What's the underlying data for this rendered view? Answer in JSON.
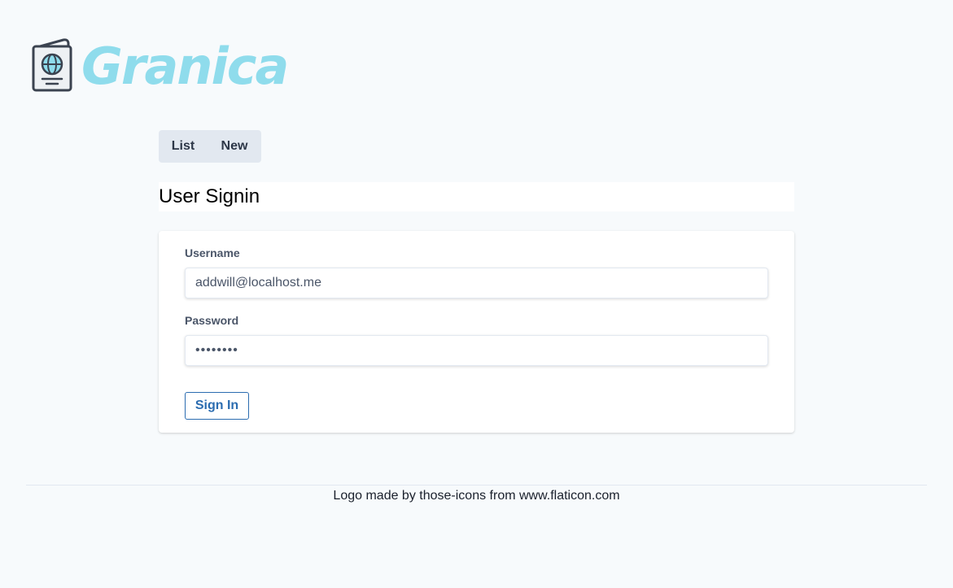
{
  "brand": {
    "name": "Granica",
    "icon": "passport-icon",
    "color": "#8fdcec"
  },
  "nav": {
    "list_label": "List",
    "new_label": "New"
  },
  "page": {
    "title": "User Signin"
  },
  "form": {
    "username_label": "Username",
    "username_value": "addwill@localhost.me",
    "password_label": "Password",
    "password_value": "••••••••",
    "submit_label": "Sign In"
  },
  "footer": {
    "text": "Logo made by those-icons from www.flaticon.com"
  },
  "colors": {
    "background": "#f7fafc",
    "nav_button_bg": "#e2e8f0",
    "primary": "#2b6cb0"
  }
}
